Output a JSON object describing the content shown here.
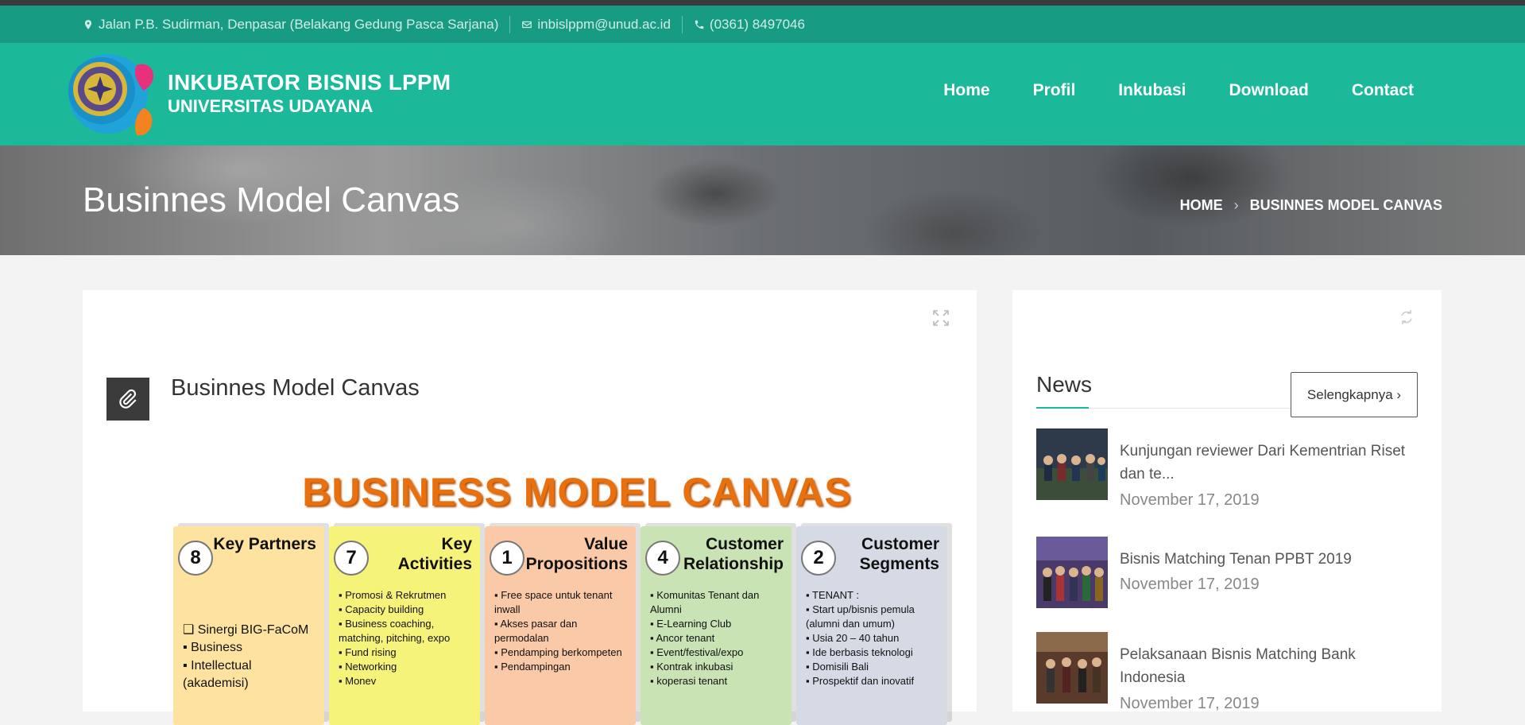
{
  "topbar": {
    "address": "Jalan P.B. Sudirman, Denpasar (Belakang Gedung Pasca Sarjana)",
    "email": "inbislppm@unud.ac.id",
    "phone": "(0361) 8497046"
  },
  "brand": {
    "line1": "INKUBATOR BISNIS LPPM",
    "line2": "UNIVERSITAS UDAYANA"
  },
  "nav": [
    "Home",
    "Profil",
    "Inkubasi",
    "Download",
    "Contact"
  ],
  "hero": {
    "title": "Businnes Model Canvas",
    "breadcrumb": [
      "HOME",
      "BUSINNES MODEL CANVAS"
    ]
  },
  "post": {
    "title": "Businnes Model Canvas",
    "canvas_title": "BUSINESS MODEL CANVAS",
    "cells": [
      {
        "num": "8",
        "heading": "Key Partners",
        "items": [
          "❑  Sinergi BIG-FaCoM",
          "   ▪ Business",
          "   ▪ Intellectual",
          "     (akademisi)"
        ]
      },
      {
        "num": "7",
        "heading": "Key Activities",
        "items": [
          "Promosi & Rekrutmen",
          "Capacity building",
          "Business coaching, matching, pitching, expo",
          "Fund rising",
          "Networking",
          "Monev"
        ]
      },
      {
        "num": "1",
        "heading": "Value Propositions",
        "items": [
          "Free space untuk tenant inwall",
          "Akses pasar dan permodalan",
          "Pendamping berkompeten",
          "Pendampingan"
        ]
      },
      {
        "num": "4",
        "heading": "Customer Relationship",
        "items": [
          "Komunitas Tenant dan Alumni",
          "E-Learning Club",
          "Ancor tenant",
          "Event/festival/expo",
          "Kontrak inkubasi",
          "koperasi tenant"
        ]
      },
      {
        "num": "2",
        "heading": "Customer Segments",
        "items": [
          "TENANT :",
          "Start up/bisnis pemula (alumni dan umum)",
          "Usia 20 – 40 tahun",
          "Ide berbasis teknologi",
          "Domisili Bali",
          "Prospektif dan inovatif"
        ]
      }
    ]
  },
  "news": {
    "heading": "News",
    "more_label": "Selengkapnya ›",
    "items": [
      {
        "title": "Kunjungan reviewer Dari Kementrian Riset dan te...",
        "date": "November 17, 2019"
      },
      {
        "title": "Bisnis Matching Tenan PPBT 2019",
        "date": "November 17, 2019"
      },
      {
        "title": "Pelaksanaan Bisnis Matching Bank Indonesia",
        "date": "November 17, 2019"
      }
    ]
  },
  "colors": {
    "topbar": "#179b82",
    "header": "#1bb99a",
    "canvas_title": "#e8700f"
  }
}
